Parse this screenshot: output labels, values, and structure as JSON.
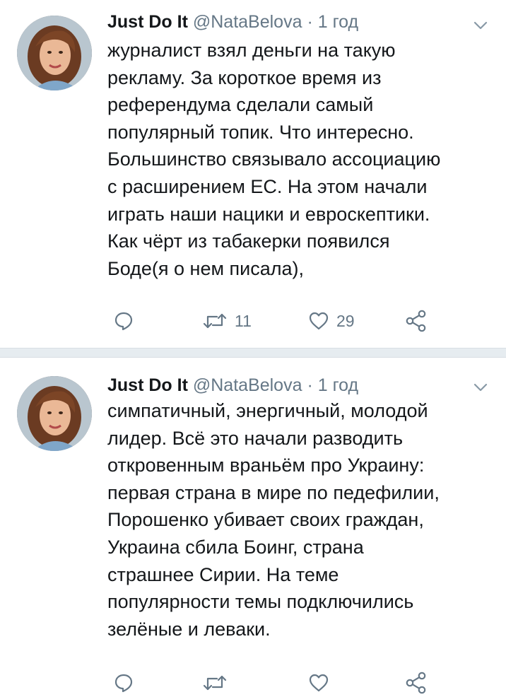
{
  "tweets": [
    {
      "author_name": "Just Do It",
      "handle": "@NataBelova",
      "separator": "·",
      "time": "1 год",
      "lines": [
        "журналист взял деньги на такую",
        "рекламу. За короткое время из",
        "референдума сделали самый",
        "популярный топик. Что интересно.",
        "Большинство связывало ассоциацию",
        "с расширением ЕС. На этом начали",
        "играть наши нацики и евроскептики.",
        "Как чёрт из табакерки появился",
        "Боде(я о нем писала),"
      ],
      "actions": {
        "reply_icon": "reply-icon",
        "retweet_icon": "retweet-icon",
        "retweet_count": "11",
        "like_icon": "heart-icon",
        "like_count": "29",
        "share_icon": "share-icon"
      }
    },
    {
      "author_name": "Just Do It",
      "handle": "@NataBelova",
      "separator": "·",
      "time": "1 год",
      "lines": [
        "симпатичный, энергичный, молодой",
        "лидер. Всё это начали разводить",
        "откровенным враньём про Украину:",
        "первая страна в мире по педефилии,",
        "Порошенко убивает своих граждан,",
        "Украина сбила Боинг, страна",
        "страшнее Сирии. На теме",
        "популярности темы подключились",
        "зелёные и леваки."
      ]
    }
  ],
  "colors": {
    "text": "#14171a",
    "secondary": "#657786",
    "divider": "#e6ecf0"
  }
}
